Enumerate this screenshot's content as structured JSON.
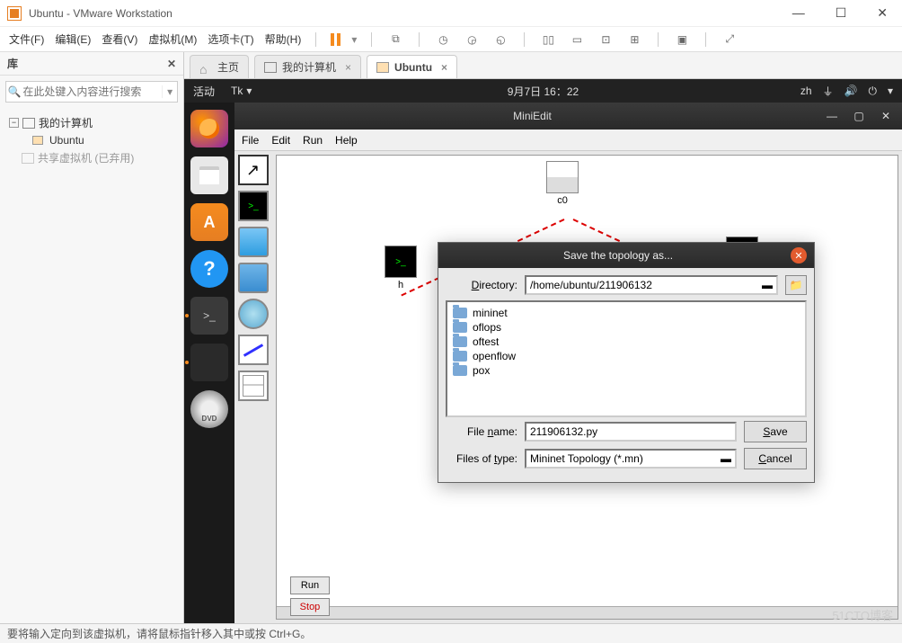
{
  "titlebar": {
    "title": "Ubuntu - VMware Workstation"
  },
  "menubar": {
    "items": [
      "文件(F)",
      "编辑(E)",
      "查看(V)",
      "虚拟机(M)",
      "选项卡(T)",
      "帮助(H)"
    ]
  },
  "sidebar": {
    "header": "库",
    "search_placeholder": "在此处键入内容进行搜索",
    "tree": {
      "root": "我的计算机",
      "vm": "Ubuntu",
      "shared": "共享虚拟机 (已弃用)"
    }
  },
  "tabs": {
    "home": "主页",
    "mycomputer": "我的计算机",
    "ubuntu": "Ubuntu"
  },
  "gnome": {
    "activities": "活动",
    "appmenu": "Tk",
    "clock": "9月7日 16：22",
    "lang": "zh"
  },
  "miniedit": {
    "title": "MiniEdit",
    "menu": [
      "File",
      "Edit",
      "Run",
      "Help"
    ],
    "nodes": {
      "controller": "c0",
      "host": "h"
    },
    "run": "Run",
    "stop": "Stop"
  },
  "dialog": {
    "title": "Save the topology as...",
    "directory_label": "Directory:",
    "directory_value": "/home/ubuntu/211906132",
    "folders": [
      "mininet",
      "oflops",
      "oftest",
      "openflow",
      "pox"
    ],
    "filename_label": "File name:",
    "filename_value": "211906132.py",
    "filetype_label": "Files of type:",
    "filetype_value": "Mininet Topology (*.mn)",
    "save": "Save",
    "cancel": "Cancel"
  },
  "status": "要将输入定向到该虚拟机，请将鼠标指针移入其中或按 Ctrl+G。",
  "watermark": "51CTO博客"
}
